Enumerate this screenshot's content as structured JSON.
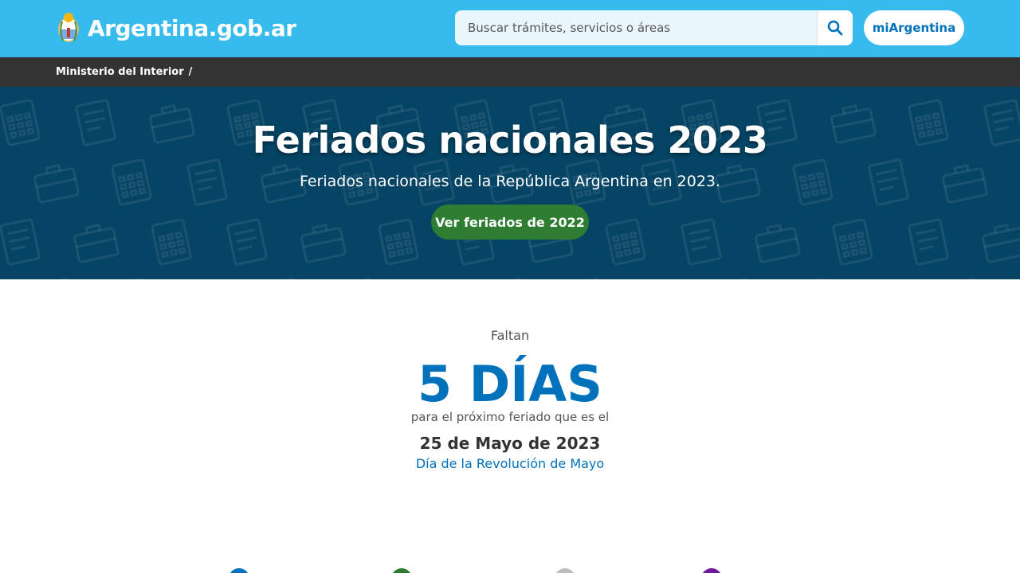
{
  "header": {
    "site_name": "Argentina.gob.ar",
    "search_placeholder": "Buscar trámites, servicios o áreas",
    "search_icon": "search-icon",
    "account_button": "miArgentina"
  },
  "breadcrumb": {
    "items": [
      "Ministerio del Interior"
    ],
    "separator": "/"
  },
  "hero": {
    "title": "Feriados nacionales 2023",
    "subtitle": "Feriados nacionales de la República Argentina en 2023.",
    "button_label": "Ver feriados de 2022"
  },
  "countdown": {
    "label": "Faltan",
    "big_text": "5 DÍAS",
    "sub_text": "para el próximo feriado que es el",
    "date": "25 de Mayo de 2023",
    "holiday_name": "Día de la Revolución de Mayo"
  },
  "legend_dots": [
    {
      "color": "#0072bb"
    },
    {
      "color": "#2e7d33"
    },
    {
      "color": "#bdbdbd"
    },
    {
      "color": "#6a1b9a"
    }
  ],
  "colors": {
    "topbar": "#37bbed",
    "breadcrumb_bar": "#333333",
    "hero_bg": "#054464",
    "primary": "#0072bb",
    "success": "#2e7d33"
  }
}
